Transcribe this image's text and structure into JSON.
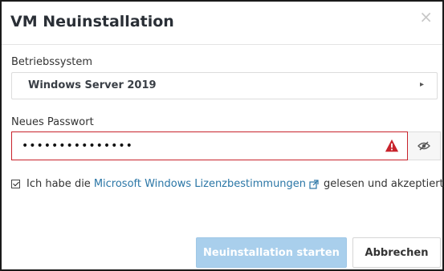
{
  "dialog": {
    "title": "VM Neuinstallation",
    "close_glyph": "×"
  },
  "os": {
    "label": "Betriebssystem",
    "selected": "Windows Server 2019",
    "chevron": "▸"
  },
  "password": {
    "label": "Neues Passwort",
    "value": "•••••••••••••••",
    "status": "error"
  },
  "license": {
    "prefix": "Ich habe die",
    "link_text": "Microsoft Windows Lizenzbestimmungen",
    "suffix": "gelesen und akzeptiert.",
    "checked": true
  },
  "actions": {
    "primary_label": "Neuinstallation starten",
    "secondary_label": "Abbrechen"
  },
  "colors": {
    "error_border": "#c8232c",
    "link": "#2a76a6",
    "primary_disabled": "#a9cfec"
  }
}
